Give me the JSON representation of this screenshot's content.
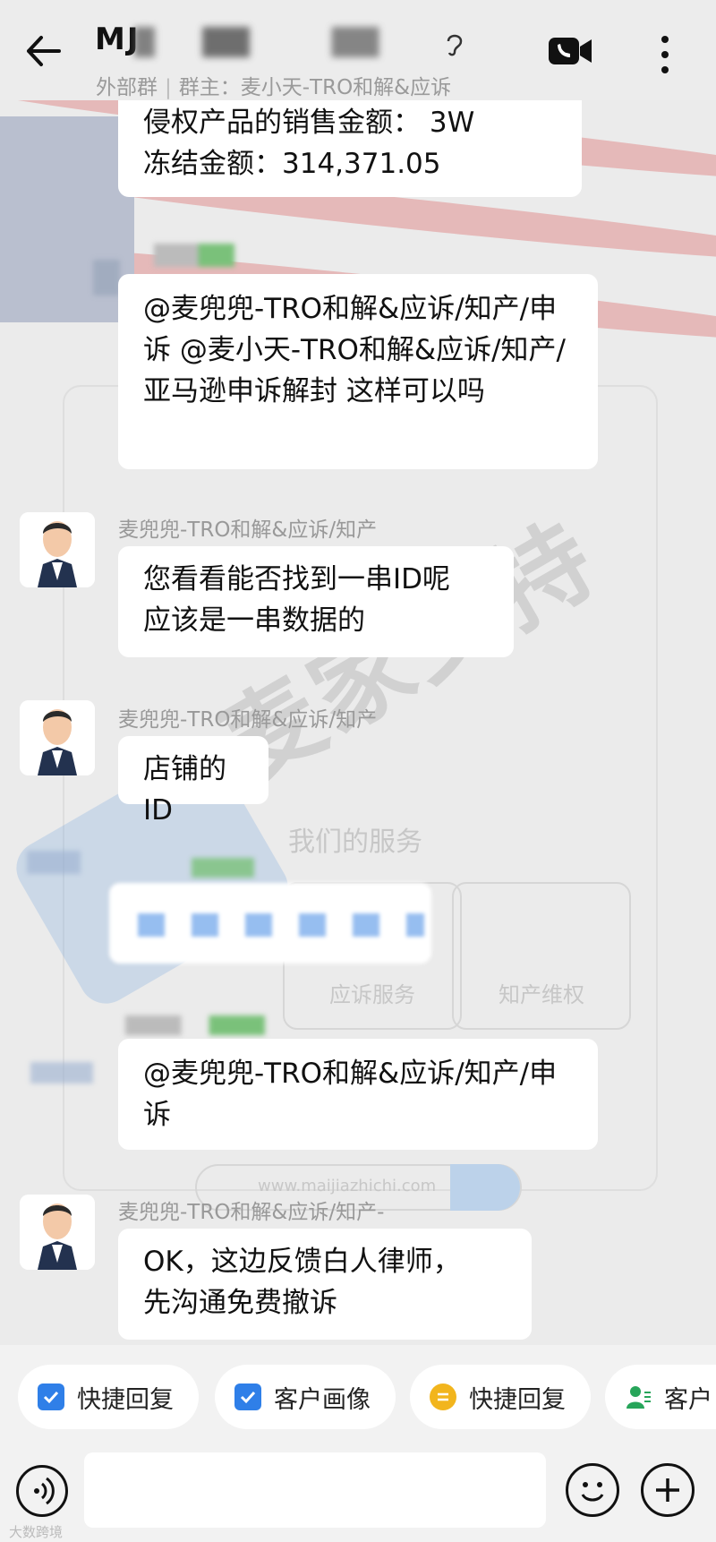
{
  "header": {
    "title": "MJ",
    "subtitle_prefix": "外部群",
    "subtitle_owner": "群主：麦小天-TRO和解&应诉"
  },
  "background": {
    "services_title": "我们的服务",
    "card_1": "应诉服务",
    "card_2": "知产维权",
    "search_url": "www.maijiazhichi.com",
    "watermark": "麦家支持"
  },
  "messages": [
    {
      "line1": "侵权产品的销售金额：  3W",
      "line2": "冻结金额：314,371.05"
    },
    {
      "text": "@麦兜兜-TRO和解&应诉/知产/申诉 @麦小天-TRO和解&应诉/知产/亚马逊申诉解封 这样可以吗"
    },
    {
      "sender": "麦兜兜-TRO和解&应诉/知产",
      "line1": "您看看能否找到一串ID呢",
      "line2": "应该是一串数据的"
    },
    {
      "sender": "麦兜兜-TRO和解&应诉/知产",
      "text": "店铺的ID"
    },
    {
      "text": "@麦兜兜-TRO和解&应诉/知产/申诉"
    },
    {
      "sender": "麦兜兜-TRO和解&应诉/知产-",
      "line1": "OK，这边反馈白人律师，",
      "line2": "先沟通免费撤诉"
    }
  ],
  "quick_actions": [
    {
      "label": "快捷回复",
      "icon": "check-square-icon",
      "color": "#2f7fe8"
    },
    {
      "label": "客户画像",
      "icon": "check-square-icon",
      "color": "#2f7fe8"
    },
    {
      "label": "快捷回复",
      "icon": "lines-circle-icon",
      "color": "#f2b51d"
    },
    {
      "label": "客户",
      "icon": "person-icon",
      "color": "#27a55a"
    }
  ],
  "footer": {
    "source_mark": "大数跨境"
  }
}
